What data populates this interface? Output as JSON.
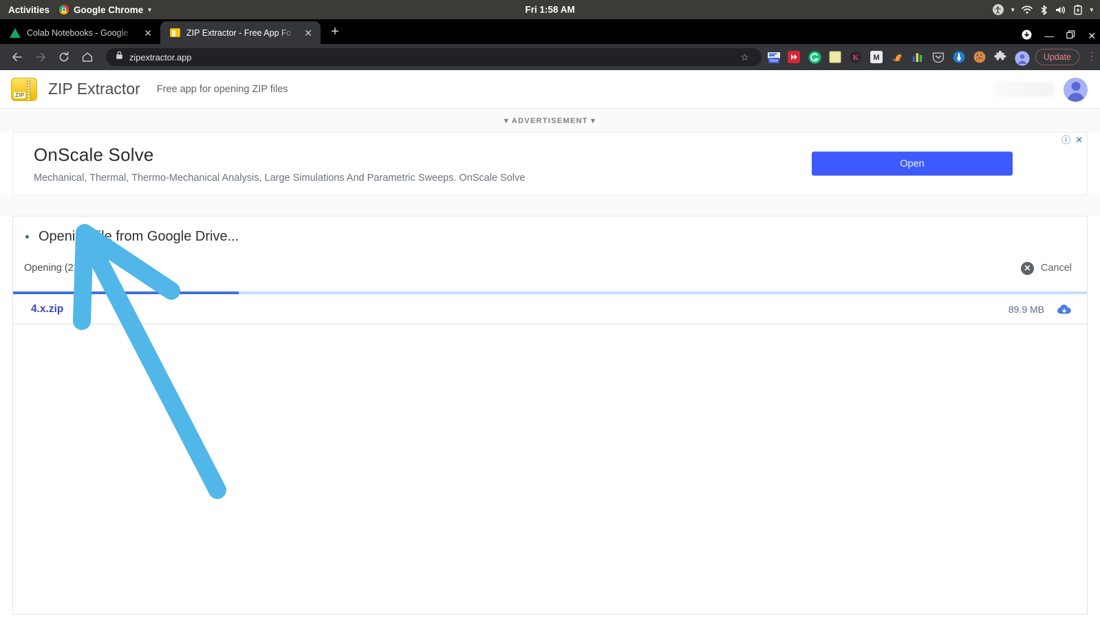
{
  "os_bar": {
    "activities": "Activities",
    "app_name": "Google Chrome",
    "clock": "Fri 1:58 AM",
    "icons": [
      "accessibility-icon",
      "wifi-icon",
      "bluetooth-icon",
      "volume-icon",
      "battery-icon"
    ]
  },
  "browser": {
    "tabs": [
      {
        "title": "Colab Notebooks - Google",
        "favicon": "google-drive-icon",
        "active": false,
        "close": "✕"
      },
      {
        "title": "ZIP Extractor - Free App Fo",
        "favicon": "zip-file-icon",
        "active": true,
        "close": "✕"
      }
    ],
    "new_tab_label": "+",
    "window_controls": {
      "download": "download-indicator-icon",
      "minimize": "—",
      "maximize": "▭",
      "close": "✕"
    },
    "nav": {
      "back": "←",
      "forward": "→",
      "reload": "⟳",
      "home": "⌂"
    },
    "omnibox": {
      "lock": "lock-icon",
      "url": "zipextractor.app",
      "star": "☆"
    },
    "extensions": [
      "new-badge-extension-icon",
      "red-video-extension-icon",
      "green-g-extension-icon",
      "yellow-note-extension-icon",
      "k-extension-icon",
      "gmail-extension-icon",
      "bird-extension-icon",
      "chart-extension-icon",
      "pocket-extension-icon",
      "blue-target-extension-icon",
      "cookie-extension-icon",
      "puzzle-extensions-icon"
    ],
    "profile": "profile-avatar",
    "update_label": "Update",
    "menu": "⋮"
  },
  "app": {
    "name": "ZIP Extractor",
    "logo_text": "ZIP",
    "tagline": "Free app for opening ZIP files"
  },
  "ad": {
    "label": "▾ ADVERTISEMENT ▾",
    "headline": "OnScale Solve",
    "description": "Mechanical, Thermal, Thermo-Mechanical Analysis, Large Simulations And Parametric Sweeps. OnScale Solve",
    "cta_label": "Open",
    "info_icon": "ⓘ",
    "close_icon": "✕"
  },
  "main": {
    "title": "Opening file from Google Drive...",
    "status": "Opening (21%)",
    "cancel_label": "Cancel",
    "cancel_icon": "✕",
    "progress_percent": 21,
    "file": {
      "name": "4.x.zip",
      "size": "89.9 MB",
      "source_icon": "cloud-download-icon"
    }
  },
  "annotation": {
    "type": "hand-drawn-arrow",
    "color": "#51b7e8",
    "points_at": "4.x.zip file row"
  }
}
